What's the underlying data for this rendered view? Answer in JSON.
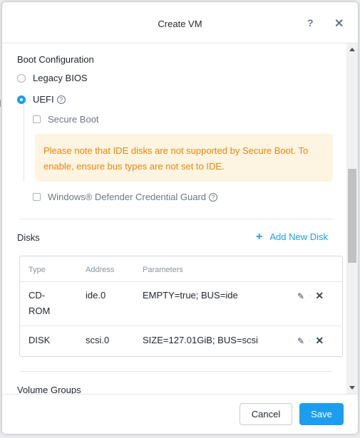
{
  "dialog": {
    "title": "Create VM",
    "help_icon": "question-mark-icon",
    "close_icon": "close-icon"
  },
  "boot": {
    "section_title": "Boot Configuration",
    "options": [
      {
        "label": "Legacy BIOS",
        "selected": false
      },
      {
        "label": "UEFI",
        "selected": true
      }
    ],
    "secure_boot_label": "Secure Boot",
    "warning": "Please note that IDE disks are not supported by Secure Boot. To enable, ensure bus types are not set to IDE.",
    "credential_guard_label": "Windows® Defender Credential Guard"
  },
  "disks": {
    "section_title": "Disks",
    "add_label": "Add New Disk",
    "columns": [
      "Type",
      "Address",
      "Parameters"
    ],
    "rows": [
      {
        "type_line1": "CD-",
        "type_line2": "ROM",
        "address": "ide.0",
        "parameters": "EMPTY=true; BUS=ide"
      },
      {
        "type_line1": "DISK",
        "type_line2": "",
        "address": "scsi.0",
        "parameters": "SIZE=127.01GiB; BUS=scsi"
      }
    ]
  },
  "volume_groups": {
    "section_title": "Volume Groups"
  },
  "footer": {
    "cancel_label": "Cancel",
    "save_label": "Save"
  },
  "colors": {
    "accent": "#1b9ef0",
    "warning_bg": "#fdf4e1",
    "warning_text": "#e8860b"
  }
}
